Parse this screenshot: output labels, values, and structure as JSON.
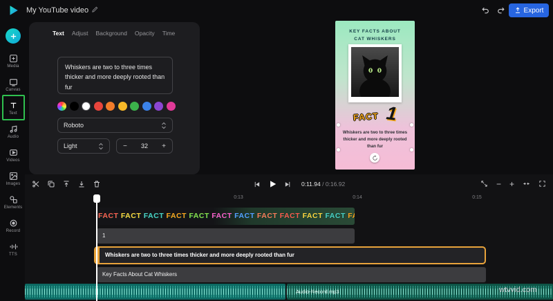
{
  "topbar": {
    "title": "My YouTube video",
    "export_label": "Export"
  },
  "sidebar": {
    "items": [
      {
        "label": "Media"
      },
      {
        "label": "Canvas"
      },
      {
        "label": "Text"
      },
      {
        "label": "Audio"
      },
      {
        "label": "Videos"
      },
      {
        "label": "Images"
      },
      {
        "label": "Elements"
      },
      {
        "label": "Record"
      },
      {
        "label": "TTS"
      }
    ]
  },
  "panel": {
    "tabs": [
      "Text",
      "Adjust",
      "Background",
      "Opacity",
      "Time"
    ],
    "active_tab": "Text",
    "text_value": "Whiskers are two to three times thicker and more deeply rooted than fur",
    "colors": [
      "multi",
      "#000000",
      "#ffffff",
      "#e8453c",
      "#f27c2a",
      "#f7b928",
      "#3cb24b",
      "#3b82e8",
      "#8b46d2",
      "#e03a98"
    ],
    "font_family": "Roboto",
    "font_weight": "Light",
    "font_size": "32",
    "decrease_label": "−",
    "increase_label": "+"
  },
  "preview": {
    "heading": "KEY FACTS ABOUT CAT WHISKERS",
    "fact_word": "FACT",
    "fact_number": "1",
    "body": "Whiskers are two to three times thicker and more deeply rooted than fur"
  },
  "timeline": {
    "transport": {
      "current_time": "0:11.94",
      "separator": " / ",
      "total_time": "0:16.92"
    },
    "ruler_labels": [
      "0:13",
      "0:14",
      "0:15"
    ],
    "zoom_out_label": "−",
    "zoom_in_label": "+",
    "fact_text": "FACT FACT FACT FACT FACT FACT FACT FACT FACT FACT FACT FACT FACT",
    "fact_palette": [
      "#ff5a4e",
      "#ffd23f",
      "#4ecdc4",
      "#ff9f1c",
      "#8bd94a",
      "#ff5ac8",
      "#5a9bff",
      "#ff7a59"
    ],
    "number_clip_label": "1",
    "whiskers_clip_label": "Whiskers are two to three times thicker and more deeply rooted than fur",
    "keyfacts_clip_label": "Key Facts About Cat Whiskers",
    "audio_clip_label": "Audio-Record.mp3"
  },
  "watermark": "wtvvid.com"
}
